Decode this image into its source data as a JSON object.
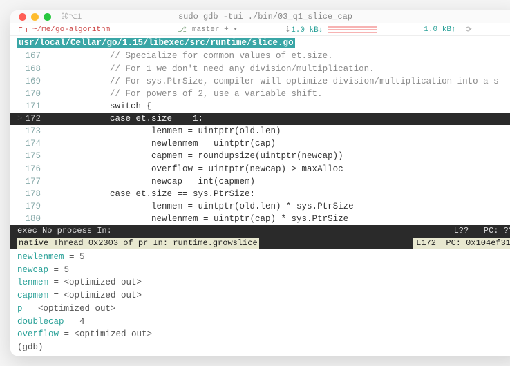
{
  "window": {
    "title": "sudo gdb -tui ./bin/03_q1_slice_cap",
    "shortcut": "⌘⌥1"
  },
  "infobar": {
    "path_label": "~/me/go-algorithm",
    "branch_icon": "⎇",
    "branch_label": "master + •",
    "net_down_icon": "⇣",
    "net_down": "1.0 kB↓",
    "net_up": "1.0 kB↑",
    "sync_icon": "⟳"
  },
  "source": {
    "filepath": "usr/local/Cellar/go/1.15/libexec/src/runtime/slice.go",
    "current_line": 172,
    "lines": [
      {
        "n": 167,
        "indent": "            ",
        "text": "// Specialize for common values of et.size.",
        "comment": true
      },
      {
        "n": 168,
        "indent": "            ",
        "text": "// For 1 we don't need any division/multiplication.",
        "comment": true
      },
      {
        "n": 169,
        "indent": "            ",
        "text": "// For sys.PtrSize, compiler will optimize division/multiplication into a s",
        "comment": true
      },
      {
        "n": 170,
        "indent": "            ",
        "text": "// For powers of 2, use a variable shift.",
        "comment": true
      },
      {
        "n": 171,
        "indent": "            ",
        "text": "switch {",
        "comment": false
      },
      {
        "n": 172,
        "indent": "            ",
        "text": "case et.size == 1:",
        "comment": false
      },
      {
        "n": 173,
        "indent": "                    ",
        "text": "lenmem = uintptr(old.len)",
        "comment": false
      },
      {
        "n": 174,
        "indent": "                    ",
        "text": "newlenmem = uintptr(cap)",
        "comment": false
      },
      {
        "n": 175,
        "indent": "                    ",
        "text": "capmem = roundupsize(uintptr(newcap))",
        "comment": false
      },
      {
        "n": 176,
        "indent": "                    ",
        "text": "overflow = uintptr(newcap) > maxAlloc",
        "comment": false
      },
      {
        "n": 177,
        "indent": "                    ",
        "text": "newcap = int(capmem)",
        "comment": false
      },
      {
        "n": 178,
        "indent": "            ",
        "text": "case et.size == sys.PtrSize:",
        "comment": false
      },
      {
        "n": 179,
        "indent": "                    ",
        "text": "lenmem = uintptr(old.len) * sys.PtrSize",
        "comment": false
      },
      {
        "n": 180,
        "indent": "                    ",
        "text": "newlenmem = uintptr(cap) * sys.PtrSize",
        "comment": false
      }
    ]
  },
  "status": {
    "row1_left": "exec No process In:",
    "row1_right": "L??   PC: ??",
    "row2_left": "native Thread 0x2303 of pr In: runtime.growslice",
    "row2_right": "L172  PC: 0x104ef31"
  },
  "gdb": {
    "vars": [
      {
        "name": "newlenmem",
        "value": "5"
      },
      {
        "name": "newcap",
        "value": "5"
      },
      {
        "name": "lenmem",
        "value": "<optimized out>"
      },
      {
        "name": "capmem",
        "value": "<optimized out>"
      },
      {
        "name": "p",
        "value": "<optimized out>"
      },
      {
        "name": "doublecap",
        "value": "4"
      },
      {
        "name": "overflow",
        "value": "<optimized out>"
      }
    ],
    "prompt": "(gdb) "
  }
}
